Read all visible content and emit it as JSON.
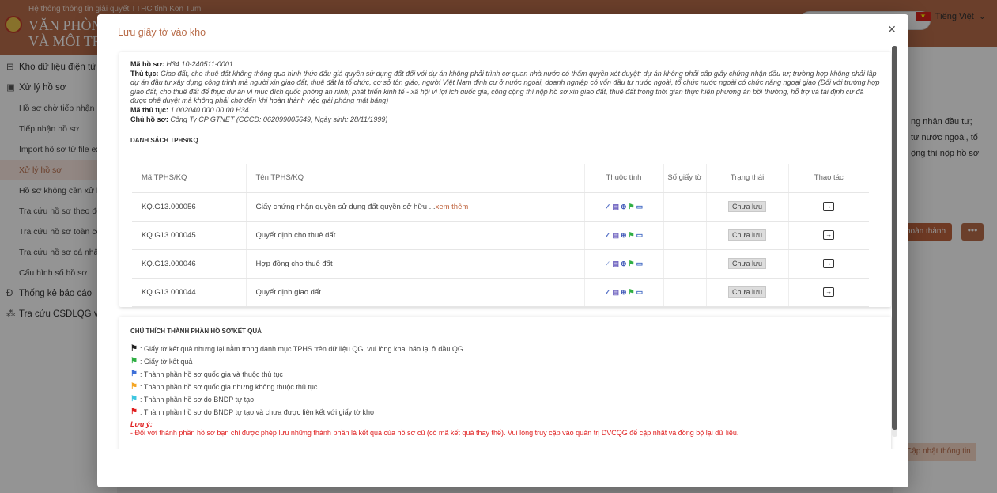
{
  "app": {
    "system_name": "Hệ thống thông tin giải quyết TTHC tỉnh Kon Tum",
    "brand_line1": "VĂN PHÒNG",
    "brand_line2": "VÀ MÔI TRƯỜ",
    "language": "Tiếng Việt"
  },
  "sidebar": {
    "items": [
      {
        "label": "Kho dữ liệu điện tử",
        "icon": "⊟",
        "level": "top"
      },
      {
        "label": "Xử lý hồ sơ",
        "icon": "▣",
        "level": "top"
      },
      {
        "label": "Hồ sơ chờ tiếp nhận",
        "level": "sub"
      },
      {
        "label": "Tiếp nhận hồ sơ",
        "level": "sub"
      },
      {
        "label": "Import hồ sơ từ file exc",
        "level": "sub"
      },
      {
        "label": "Xử lý hồ sơ",
        "level": "sub",
        "active": true
      },
      {
        "label": "Hồ sơ không cần xử lý",
        "level": "sub"
      },
      {
        "label": "Tra cứu hồ sơ theo đơn",
        "level": "sub"
      },
      {
        "label": "Tra cứu hồ sơ toàn cơ q",
        "level": "sub"
      },
      {
        "label": "Tra cứu hồ sơ cá nhân",
        "level": "sub"
      },
      {
        "label": "Cấu hình số hồ sơ",
        "level": "sub"
      },
      {
        "label": "Thống kê báo cáo",
        "icon": "Ð",
        "level": "top"
      },
      {
        "label": "Tra cứu CSDLQG về đấ",
        "icon": "⁂",
        "level": "top"
      }
    ]
  },
  "background_main": {
    "text_lines": [
      "ng nhận đầu tư;",
      "tư nước ngoài, tố",
      "ộng thì nộp hồ sơ"
    ],
    "complete_button": "hoàn thành",
    "more_button": "•••",
    "update_button": "Cập nhật thông tin"
  },
  "modal": {
    "title": "Lưu giấy tờ vào kho",
    "close_icon": "×",
    "dossier": {
      "code_label": "Mã hồ sơ:",
      "code_value": "H34.10-240511-0001",
      "procedure_label": "Thủ tục:",
      "procedure_value": "Giao đất, cho thuê đất không thông qua hình thức đấu giá quyền sử dụng đất đối với dự án không phải trình cơ quan nhà nước có thẩm quyền xét duyệt; dự án không phải cấp giấy chứng nhận đầu tư; trường hợp không phải lập dự án đầu tư xây dựng công trình mà người xin giao đất, thuê đất là tổ chức, cơ sở tôn giáo, người Việt Nam định cư ở nước ngoài, doanh nghiệp có vốn đầu tư nước ngoài, tổ chức nước ngoài có chức năng ngoại giao (Đối với trường hợp giao đất, cho thuê đất để thực dự án vì mục đích quốc phòng an ninh; phát triển kinh tế - xã hội vì lợi ích quốc gia, công cộng thì nộp hồ sơ xin giao đất, thuê đất trong thời gian thực hiện phương án bồi thường, hỗ trợ và tái định cư đã được phê duyệt mà không phải chờ đến khi hoàn thành việc giải phóng mặt bằng)",
      "procedure_code_label": "Mã thủ tục:",
      "procedure_code_value": "1.002040.000.00.00.H34",
      "owner_label": "Chủ hồ sơ:",
      "owner_value": "Công Ty CP GTNET (CCCD: 062099005649, Ngày sinh: 28/11/1999)"
    },
    "list_title": "DANH SÁCH TPHS/KQ",
    "table": {
      "headers": {
        "code": "Mã TPHS/KQ",
        "name": "Tên TPHS/KQ",
        "attrs": "Thuộc tính",
        "num": "Số giấy tờ",
        "status": "Trạng thái",
        "action": "Thao tác"
      },
      "rows": [
        {
          "code": "KQ.G13.000056",
          "name": "Giấy chứng nhận quyền sử dụng đất quyền sở hữu ...",
          "see_more": "xem thêm",
          "num": "",
          "status": "Chưa lưu"
        },
        {
          "code": "KQ.G13.000045",
          "name": "Quyết định cho thuê đất",
          "see_more": "",
          "num": "",
          "status": "Chưa lưu"
        },
        {
          "code": "KQ.G13.000046",
          "name": "Hợp đồng cho thuê đất",
          "see_more": "",
          "num": "",
          "status": "Chưa lưu"
        },
        {
          "code": "KQ.G13.000044",
          "name": "Quyết định giao đất",
          "see_more": "",
          "num": "",
          "status": "Chưa lưu"
        }
      ]
    },
    "legend": {
      "title": "CHÚ THÍCH THÀNH PHẦN HỒ SƠ/KẾT QUẢ",
      "items": [
        {
          "color": "#222222",
          "text": ": Giấy tờ kết quả nhưng lại nằm trong danh mục TPHS trên dữ liệu QG, vui lòng khai báo lại ở đầu QG"
        },
        {
          "color": "#2fae43",
          "text": ": Giấy tờ kết quả"
        },
        {
          "color": "#3d6fd8",
          "text": ": Thành phần hồ sơ quốc gia và thuộc thủ tục"
        },
        {
          "color": "#f5a623",
          "text": ": Thành phần hồ sơ quốc gia nhưng không thuộc thủ tục"
        },
        {
          "color": "#3ec6e0",
          "text": ": Thành phần hồ sơ do BNDP tự tạo"
        },
        {
          "color": "#e02020",
          "text": ": Thành phần hồ sơ do BNDP tự tạo và chưa được liên kết với giấy tờ kho"
        }
      ],
      "note_title": "Lưu ý:",
      "note_text": "- Đối với thành phần hồ sơ bạn chỉ được phép lưu những thành phần là kết quả của hồ sơ cũ (có mã kết quả thay thế). Vui lòng truy cập vào quản trị DVCQG để cập nhật và đồng bộ lại dữ liệu."
    }
  }
}
